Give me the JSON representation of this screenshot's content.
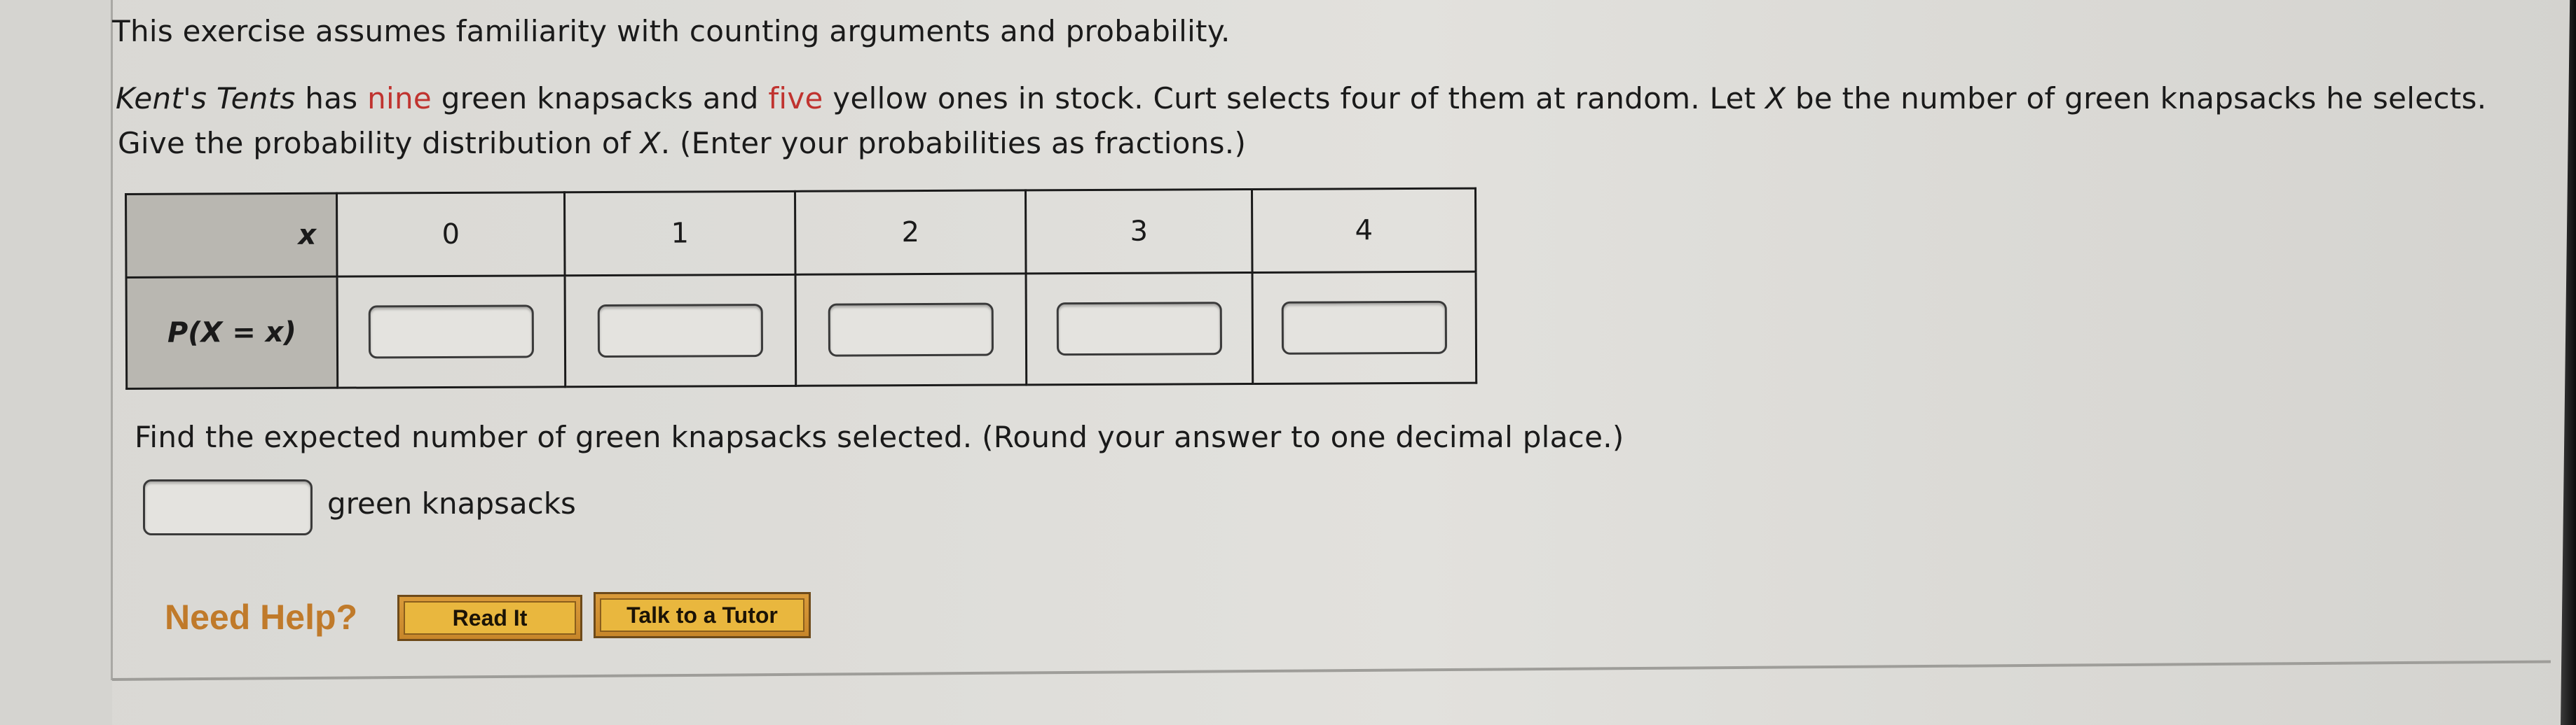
{
  "intro": "This exercise assumes familiarity with counting arguments and probability.",
  "question": {
    "company": "Kent's Tents",
    "has": " has ",
    "green_count": "nine",
    "green_text": " green knapsacks and ",
    "yellow_count": "five",
    "yellow_text": " yellow ones in stock. Curt selects four of them at random. Let ",
    "var": "X",
    "rest": " be the number of green knapsacks he selects.",
    "line2_start": "Give the probability distribution of ",
    "line2_var": "X",
    "line2_end": ". (Enter your probabilities as fractions.)"
  },
  "table": {
    "row1_header": "x",
    "row2_header": "P(X = x)",
    "x_values": [
      "0",
      "1",
      "2",
      "3",
      "4"
    ],
    "probabilities": [
      "",
      "",
      "",
      "",
      ""
    ]
  },
  "expected": {
    "prompt": "Find the expected number of green knapsacks selected. (Round your answer to one decimal place.)",
    "value": "",
    "unit": "green knapsacks"
  },
  "help": {
    "label": "Need Help?",
    "read_it": "Read It",
    "tutor": "Talk to a Tutor"
  },
  "colors": {
    "highlight_red": "#c0332f",
    "help_orange": "#c07a2a",
    "button_yellow": "#e9b73e",
    "table_header_bg": "#b9b7b1"
  }
}
